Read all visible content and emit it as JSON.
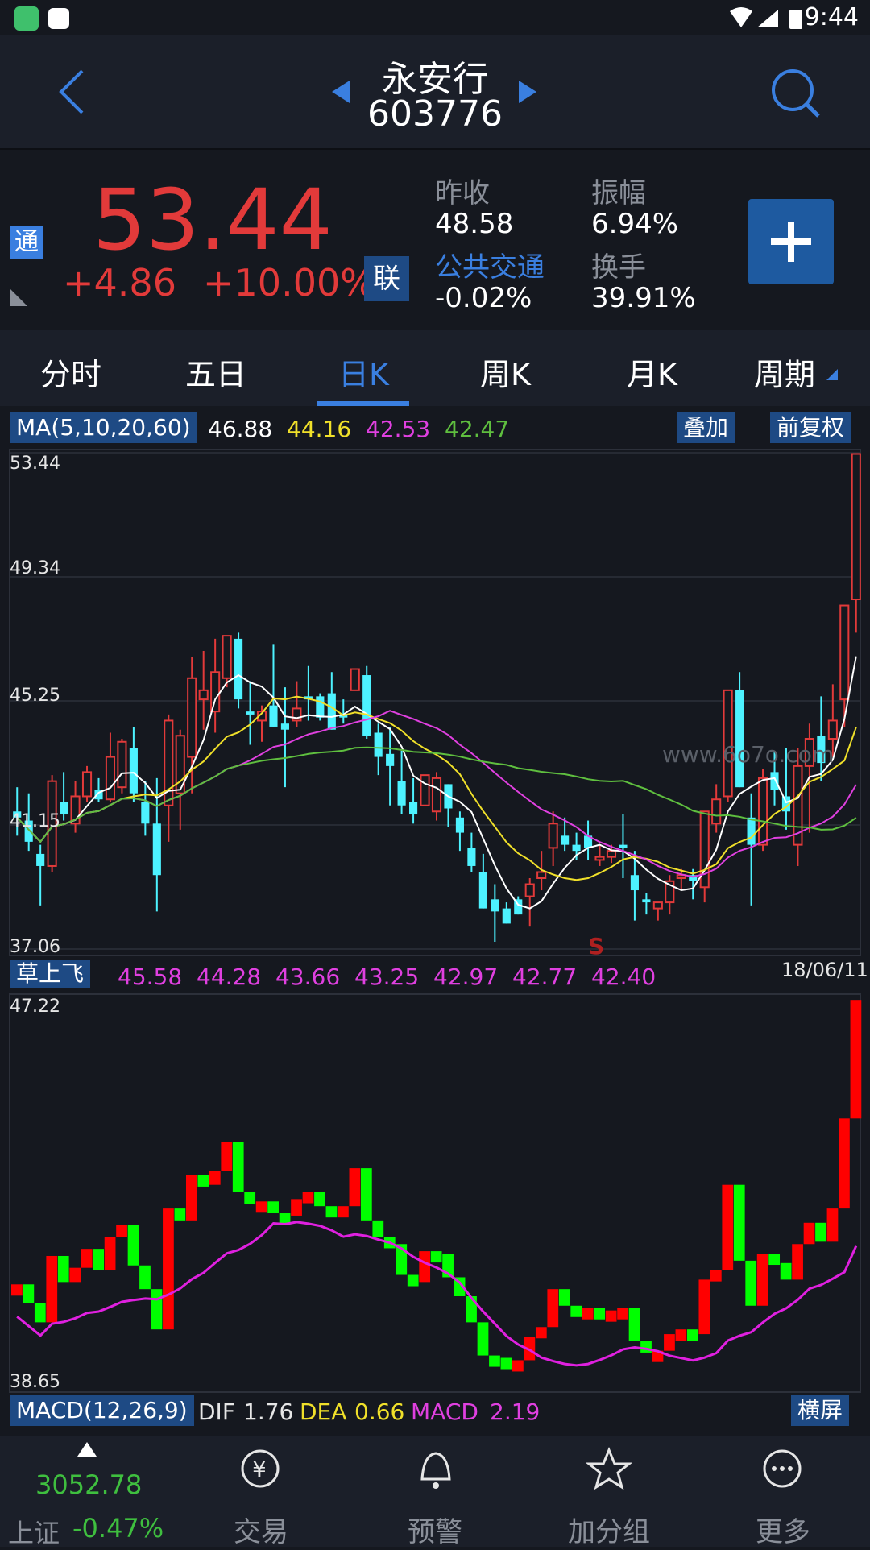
{
  "status_bar": {
    "time": "9:44"
  },
  "header": {
    "stock_name": "永安行",
    "stock_code": "603776"
  },
  "quote": {
    "price": "53.44",
    "change_abs": "+4.86",
    "change_pct": "+10.00%",
    "badge_tong": "通",
    "badge_lian": "联",
    "prev_close_label": "昨收",
    "prev_close": "48.58",
    "amplitude_label": "振幅",
    "amplitude": "6.94%",
    "sector_label": "公共交通",
    "sector_change": "-0.02%",
    "turnover_label": "换手",
    "turnover": "39.91%"
  },
  "tabs": [
    {
      "label": "分时"
    },
    {
      "label": "五日"
    },
    {
      "label": "日K"
    },
    {
      "label": "周K"
    },
    {
      "label": "月K"
    },
    {
      "label": "周期"
    }
  ],
  "active_tab": "日K",
  "ma_bar": {
    "indicator": "MA(5,10,20,60)",
    "ma5": "46.88",
    "ma10": "44.16",
    "ma20": "42.53",
    "ma60": "42.47",
    "overlay_button": "叠加",
    "adjust_button": "前复权"
  },
  "kline": {
    "y_labels": [
      "53.44",
      "49.34",
      "45.25",
      "41.15",
      "37.06"
    ],
    "watermark": "www.6o7o.com",
    "signal": "S",
    "date": "18/06/11"
  },
  "indicator_bar": {
    "name": "草上飞",
    "values": [
      "45.58",
      "44.28",
      "43.66",
      "43.25",
      "42.97",
      "42.77",
      "42.40"
    ]
  },
  "sub_chart": {
    "y_top": "47.22",
    "y_bottom": "38.65"
  },
  "macd_bar": {
    "indicator": "MACD(12,26,9)",
    "dif_label": "DIF",
    "dif": "1.76",
    "dea_label": "DEA",
    "dea": "0.66",
    "macd_label": "MACD",
    "macd": "2.19",
    "landscape_button": "横屏"
  },
  "bottom_nav": {
    "index_value": "3052.78",
    "index_name": "上证",
    "index_change": "-0.47%",
    "items": [
      {
        "label": "交易",
        "icon": "yen-cycle-icon"
      },
      {
        "label": "预警",
        "icon": "bell-icon"
      },
      {
        "label": "加分组",
        "icon": "star-icon"
      },
      {
        "label": "更多",
        "icon": "more-icon"
      }
    ]
  },
  "colors": {
    "up": "#e23a3a",
    "down": "#4df2ff",
    "ma5": "#ffffff",
    "ma10": "#f0e02a",
    "ma20": "#e040e0",
    "ma60": "#5fbf3f",
    "accent": "#3a7fe0"
  },
  "chart_data": {
    "type": "candlestick",
    "ylim": [
      37.06,
      53.44
    ],
    "ma_series": [
      {
        "name": "MA5",
        "last": 46.88
      },
      {
        "name": "MA10",
        "last": 44.16
      },
      {
        "name": "MA20",
        "last": 42.53
      },
      {
        "name": "MA60",
        "last": 42.47
      }
    ],
    "candles_ohlc": [
      [
        41.6,
        42.4,
        40.8,
        41.4
      ],
      [
        41.3,
        42.2,
        40.3,
        40.6
      ],
      [
        40.2,
        40.5,
        38.5,
        39.8
      ],
      [
        39.8,
        42.8,
        39.6,
        42.6
      ],
      [
        41.9,
        42.9,
        41.3,
        41.5
      ],
      [
        41.2,
        42.6,
        40.9,
        42.1
      ],
      [
        42.1,
        43.1,
        41.9,
        42.9
      ],
      [
        42.3,
        42.7,
        41.9,
        42.0
      ],
      [
        42.0,
        44.2,
        41.9,
        43.4
      ],
      [
        42.4,
        44.0,
        42.2,
        43.9
      ],
      [
        43.7,
        44.4,
        41.9,
        42.2
      ],
      [
        41.9,
        42.6,
        40.8,
        41.2
      ],
      [
        41.2,
        42.7,
        38.3,
        39.5
      ],
      [
        41.8,
        44.8,
        40.6,
        44.6
      ],
      [
        42.2,
        44.3,
        41.0,
        44.1
      ],
      [
        43.4,
        46.7,
        42.2,
        46.0
      ],
      [
        45.3,
        46.9,
        44.3,
        45.6
      ],
      [
        44.9,
        47.3,
        44.2,
        46.2
      ],
      [
        46.0,
        47.3,
        45.7,
        47.4
      ],
      [
        47.3,
        47.5,
        45.0,
        45.3
      ],
      [
        44.9,
        45.9,
        43.8,
        44.8
      ],
      [
        44.6,
        45.1,
        43.9,
        44.9
      ],
      [
        45.1,
        47.1,
        44.6,
        44.4
      ],
      [
        44.5,
        45.7,
        42.4,
        44.3
      ],
      [
        44.6,
        45.9,
        44.4,
        45.0
      ],
      [
        45.4,
        46.4,
        44.6,
        45.3
      ],
      [
        45.4,
        45.5,
        44.6,
        44.7
      ],
      [
        45.5,
        46.2,
        44.6,
        44.3
      ],
      [
        44.8,
        45.3,
        44.5,
        44.7
      ],
      [
        45.6,
        46.3,
        45.6,
        46.3
      ],
      [
        46.1,
        46.4,
        44.0,
        44.1
      ],
      [
        44.2,
        44.5,
        42.8,
        43.4
      ],
      [
        43.5,
        44.4,
        41.8,
        43.1
      ],
      [
        42.6,
        43.6,
        41.5,
        41.8
      ],
      [
        41.9,
        42.7,
        41.2,
        41.5
      ],
      [
        41.8,
        42.2,
        41.8,
        42.8
      ],
      [
        41.6,
        42.9,
        41.3,
        42.7
      ],
      [
        42.5,
        42.5,
        41.1,
        41.7
      ],
      [
        41.4,
        41.6,
        40.3,
        40.9
      ],
      [
        40.4,
        40.9,
        39.6,
        39.8
      ],
      [
        39.6,
        40.2,
        38.8,
        38.4
      ],
      [
        38.7,
        39.2,
        37.3,
        38.3
      ],
      [
        38.4,
        38.6,
        38.3,
        37.9
      ],
      [
        38.7,
        38.8,
        38.2,
        38.2
      ],
      [
        38.8,
        39.4,
        37.8,
        39.2
      ],
      [
        39.4,
        40.3,
        39.0,
        39.6
      ],
      [
        40.4,
        41.6,
        39.8,
        41.2
      ],
      [
        40.8,
        41.4,
        40.3,
        40.5
      ],
      [
        40.5,
        40.9,
        40.0,
        40.3
      ],
      [
        40.8,
        41.3,
        40.0,
        40.4
      ],
      [
        40.0,
        40.5,
        39.8,
        40.1
      ],
      [
        40.1,
        40.5,
        39.9,
        40.3
      ],
      [
        40.5,
        41.5,
        39.4,
        40.4
      ],
      [
        39.5,
        40.3,
        38.0,
        39.0
      ],
      [
        38.7,
        38.9,
        38.2,
        38.6
      ],
      [
        38.4,
        38.6,
        38.0,
        38.6
      ],
      [
        38.6,
        39.5,
        38.2,
        39.3
      ],
      [
        39.4,
        39.7,
        39.0,
        39.5
      ],
      [
        39.5,
        39.7,
        38.7,
        39.3
      ],
      [
        39.1,
        41.6,
        38.6,
        41.6
      ],
      [
        41.2,
        42.5,
        40.9,
        42.0
      ],
      [
        42.1,
        45.0,
        41.9,
        45.6
      ],
      [
        45.6,
        46.2,
        42.8,
        42.4
      ],
      [
        41.4,
        42.2,
        38.5,
        40.5
      ],
      [
        40.5,
        43.0,
        40.3,
        42.7
      ],
      [
        42.9,
        43.6,
        41.8,
        42.3
      ],
      [
        42.1,
        43.7,
        41.0,
        41.6
      ],
      [
        40.5,
        43.7,
        39.8,
        43.1
      ],
      [
        43.1,
        44.5,
        40.9,
        44.0
      ],
      [
        44.1,
        45.4,
        42.6,
        43.2
      ],
      [
        44.0,
        45.8,
        43.4,
        44.6
      ],
      [
        45.3,
        48.3,
        44.4,
        48.4
      ],
      [
        48.6,
        53.4,
        47.5,
        53.4
      ]
    ],
    "sub_ylim": [
      38.65,
      47.22
    ]
  }
}
